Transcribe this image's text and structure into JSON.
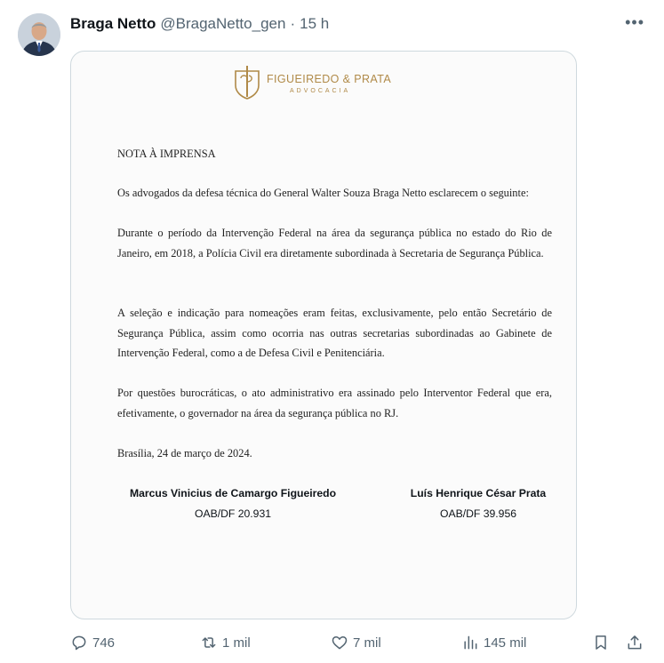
{
  "tweet": {
    "author": "Braga Netto",
    "handle": "@BragaNetto_gen",
    "separator": "·",
    "time": "15 h",
    "more_icon": "more-horizontal-icon"
  },
  "document": {
    "logo_name": "FIGUEIREDO & PRATA",
    "logo_sub": "ADVOCACIA",
    "heading": "NOTA À IMPRENSA",
    "paragraphs": [
      "Os advogados da defesa técnica do General Walter Souza Braga Netto esclarecem o seguinte:",
      "Durante o período da Intervenção Federal na área da segurança pública no estado do Rio de Janeiro, em 2018, a Polícia Civil era diretamente subordinada à Secretaria de Segurança Pública.",
      "A seleção e indicação para nomeações eram feitas, exclusivamente, pelo então Secretário de Segurança Pública, assim como ocorria nas outras secretarias subordinadas ao Gabinete de Intervenção Federal, como a de Defesa Civil e Penitenciária.",
      "Por questões burocráticas, o ato administrativo era assinado pelo Interventor Federal que era, efetivamente, o governador na área da segurança pública no RJ."
    ],
    "date_line": "Brasília, 24 de março de 2024.",
    "signatures": [
      {
        "name": "Marcus Vinicius de Camargo Figueiredo",
        "oab": "OAB/DF 20.931"
      },
      {
        "name": "Luís Henrique César Prata",
        "oab": "OAB/DF 39.956"
      }
    ]
  },
  "actions": {
    "replies": "746",
    "reposts": "1 mil",
    "likes": "7 mil",
    "views": "145 mil"
  },
  "colors": {
    "text": "#0f1419",
    "secondary": "#536471",
    "border": "#cfd9de",
    "logo_gold": "#b08a48"
  }
}
